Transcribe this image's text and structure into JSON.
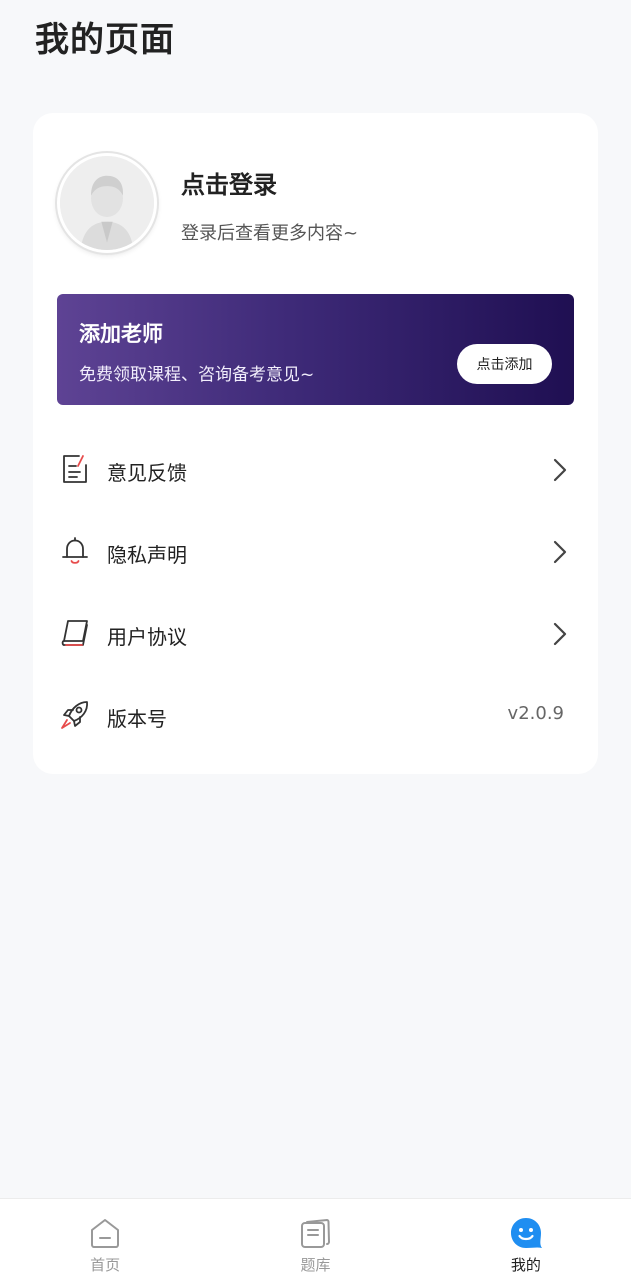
{
  "page": {
    "title": "我的页面"
  },
  "profile": {
    "login_title": "点击登录",
    "login_subtitle": "登录后查看更多内容~"
  },
  "banner": {
    "title": "添加老师",
    "subtitle": "免费领取课程、咨询备考意见~",
    "button_label": "点击添加"
  },
  "menu": {
    "items": [
      {
        "label": "意见反馈",
        "icon": "feedback-icon",
        "trailing": "chevron"
      },
      {
        "label": "隐私声明",
        "icon": "bell-icon",
        "trailing": "chevron"
      },
      {
        "label": "用户协议",
        "icon": "book-icon",
        "trailing": "chevron"
      },
      {
        "label": "版本号",
        "icon": "rocket-icon",
        "trailing": "value",
        "value": "v2.0.9"
      }
    ]
  },
  "tabbar": {
    "tabs": [
      {
        "label": "首页",
        "icon": "home-icon",
        "active": false
      },
      {
        "label": "题库",
        "icon": "question-bank-icon",
        "active": false
      },
      {
        "label": "我的",
        "icon": "smile-face-icon",
        "active": true
      }
    ]
  },
  "colors": {
    "accent_blue": "#1f8ef1",
    "icon_red": "#e74c4c",
    "banner_start": "#5e4394",
    "banner_end": "#1f0f52"
  }
}
